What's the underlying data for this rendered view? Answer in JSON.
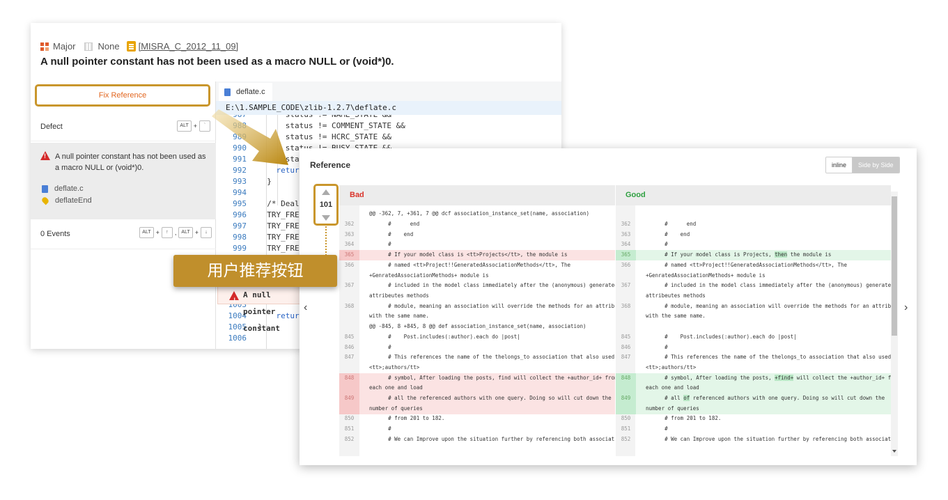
{
  "issue": {
    "severity": "Major",
    "status": "None",
    "rule": "[MISRA_C_2012_11_09]",
    "title": "A null pointer constant has not been used as a macro NULL or (void*)0."
  },
  "left_panel": {
    "fix_reference_label": "Fix Reference",
    "defect_label": "Defect",
    "defect_keys": [
      "ALT",
      "+",
      "`"
    ],
    "defect_message": "A null pointer constant has not been used as a macro NULL or (void*)0.",
    "files": [
      "deflate.c",
      "deflateEnd"
    ],
    "events_label": "0 Events",
    "events_keys": [
      "ALT",
      "+",
      "↑",
      ",",
      "ALT",
      "+",
      "↓"
    ]
  },
  "editor": {
    "tab": "deflate.c",
    "path": "E:\\1.SAMPLE_CODE\\zlib-1.2.7\\deflate.c",
    "lines": [
      {
        "n": "987",
        "t": "      status != NAME_STATE &&"
      },
      {
        "n": "988",
        "t": "      status != COMMENT_STATE &&"
      },
      {
        "n": "989",
        "t": "      status != HCRC_STATE &&"
      },
      {
        "n": "990",
        "t": "      status != BUSY_STATE &&"
      },
      {
        "n": "991",
        "t": "      status != FINISH_STATE) {"
      },
      {
        "n": "992",
        "t": "    return Z_STREAM_ERROR;"
      },
      {
        "n": "993",
        "t": "  }"
      },
      {
        "n": "994",
        "t": ""
      },
      {
        "n": "995",
        "t": "  /* Deallocate in reverse order */"
      },
      {
        "n": "996",
        "t": "  TRY_FREE(strm, strm->state->pending_buf);"
      },
      {
        "n": "997",
        "t": "  TRY_FREE(strm, strm->state->head);"
      },
      {
        "n": "998",
        "t": "  TRY_FREE(strm, strm->state->prev);"
      },
      {
        "n": "999",
        "t": "  TRY_FREE(strm, strm->state->window);"
      },
      {
        "n": "1000",
        "t": ""
      },
      {
        "n": "1001",
        "t": ""
      },
      {
        "n": "1002",
        "t": ""
      },
      {
        "n": "1003",
        "t": ""
      },
      {
        "n": "1004",
        "t": "    return status == BUSY_STATE ? Z_DATA_ERROR : Z_OK;"
      },
      {
        "n": "1005",
        "t": "}"
      },
      {
        "n": "1006",
        "t": ""
      }
    ],
    "inline_warning": "A null pointer constant"
  },
  "callout_label": "用户推荐按钮",
  "reference": {
    "title": "Reference",
    "toggle_inline": "inline",
    "toggle_side": "Side by Side",
    "counter": "101",
    "nav_prev": "‹",
    "nav_next": "›",
    "bad_label": "Bad",
    "good_label": "Good",
    "bad_lines": [
      {
        "n": "",
        "t": "@@ -362, 7, +361, 7 @@ dcf association_instance_set(name, association)",
        "hl": false
      },
      {
        "n": "362",
        "t": "      #      end",
        "hl": false
      },
      {
        "n": "363",
        "t": "      #    end",
        "hl": false
      },
      {
        "n": "364",
        "t": "      #",
        "hl": false
      },
      {
        "n": "365",
        "t": "      # If your model class is <tt>Projects</tt>, the module is",
        "hl": true
      },
      {
        "n": "366",
        "t": "      # named <tt>Project!!GeneratedAssociationMethods</tt>, The",
        "hl": false
      },
      {
        "n": "",
        "t": "+GenratedAssociationMethods+ module is",
        "hl": false
      },
      {
        "n": "367",
        "t": "      # included in the model class immediately after the (anonymous) generated",
        "hl": false
      },
      {
        "n": "",
        "t": "attribeutes methods",
        "hl": false
      },
      {
        "n": "368",
        "t": "      # module, meaning an association will override the methods for an attribute",
        "hl": false
      },
      {
        "n": "",
        "t": "with the same name.",
        "hl": false
      },
      {
        "n": "",
        "t": "@@ -845, 8 +845, 8 @@ def association_instance_set(name, association)",
        "hl": false
      },
      {
        "n": "845",
        "t": "      #    Post.includes(:author).each do |post|",
        "hl": false
      },
      {
        "n": "846",
        "t": "      #",
        "hl": false
      },
      {
        "n": "847",
        "t": "      # This references the name of the thelongs_to association that also used the",
        "hl": false
      },
      {
        "n": "",
        "t": "<tt>;authors/tt>",
        "hl": false
      },
      {
        "n": "848",
        "t": "      # symbol, After loading the posts, find will collect the +author_id+ from",
        "hl": true
      },
      {
        "n": "",
        "t": "each one and load",
        "hl": true
      },
      {
        "n": "849",
        "t": "      # all the referenced authors with one query. Doing so will cut down the",
        "hl": true
      },
      {
        "n": "",
        "t": "number of queries",
        "hl": true
      },
      {
        "n": "850",
        "t": "      # from 201 to 182.",
        "hl": false
      },
      {
        "n": "851",
        "t": "      #",
        "hl": false
      },
      {
        "n": "852",
        "t": "      # We can Improve upon the situation further by referencing both associations",
        "hl": false
      }
    ],
    "good_lines": [
      {
        "n": "",
        "t": "",
        "hl": false
      },
      {
        "n": "362",
        "t": "      #      end",
        "hl": false
      },
      {
        "n": "363",
        "t": "      #    end",
        "hl": false
      },
      {
        "n": "364",
        "t": "      #",
        "hl": false
      },
      {
        "n": "365",
        "t": "      # If your model class is <tt>Projects</tt>, then the module is",
        "hl": true
      },
      {
        "n": "366",
        "t": "      # named <tt>Project!!GeneratedAssociationMethods</tt>, The",
        "hl": false
      },
      {
        "n": "",
        "t": "+GenratedAssociationMethods+ module is",
        "hl": false
      },
      {
        "n": "367",
        "t": "      # included in the model class immediately after the (anonymous) generated",
        "hl": false
      },
      {
        "n": "",
        "t": "attribeutes methods",
        "hl": false
      },
      {
        "n": "368",
        "t": "      # module, meaning an association will override the methods for an attribute",
        "hl": false
      },
      {
        "n": "",
        "t": "with the same name.",
        "hl": false
      },
      {
        "n": "",
        "t": "",
        "hl": false
      },
      {
        "n": "845",
        "t": "      #    Post.includes(:author).each do |post|",
        "hl": false
      },
      {
        "n": "846",
        "t": "      #",
        "hl": false
      },
      {
        "n": "847",
        "t": "      # This references the name of the thelongs_to association that also used the",
        "hl": false
      },
      {
        "n": "",
        "t": "<tt>;authors/tt>",
        "hl": false
      },
      {
        "n": "848",
        "t": "      # symbol, After loading the posts, +find+ will collect the +author_id+ from",
        "hl": true
      },
      {
        "n": "",
        "t": "each one and load",
        "hl": true
      },
      {
        "n": "849",
        "t": "      # all of referenced authors with one query. Doing so will cut down the",
        "hl": true
      },
      {
        "n": "",
        "t": "number of queries",
        "hl": true
      },
      {
        "n": "850",
        "t": "      # from 201 to 182.",
        "hl": false
      },
      {
        "n": "851",
        "t": "      #",
        "hl": false
      },
      {
        "n": "852",
        "t": "      # We can Improve upon the situation further by referencing both associations",
        "hl": false
      }
    ]
  },
  "colors": {
    "accent_gold": "#c9962c",
    "bad_red": "#d9342b",
    "good_green": "#2ea040",
    "fix_text": "#e2661f"
  }
}
